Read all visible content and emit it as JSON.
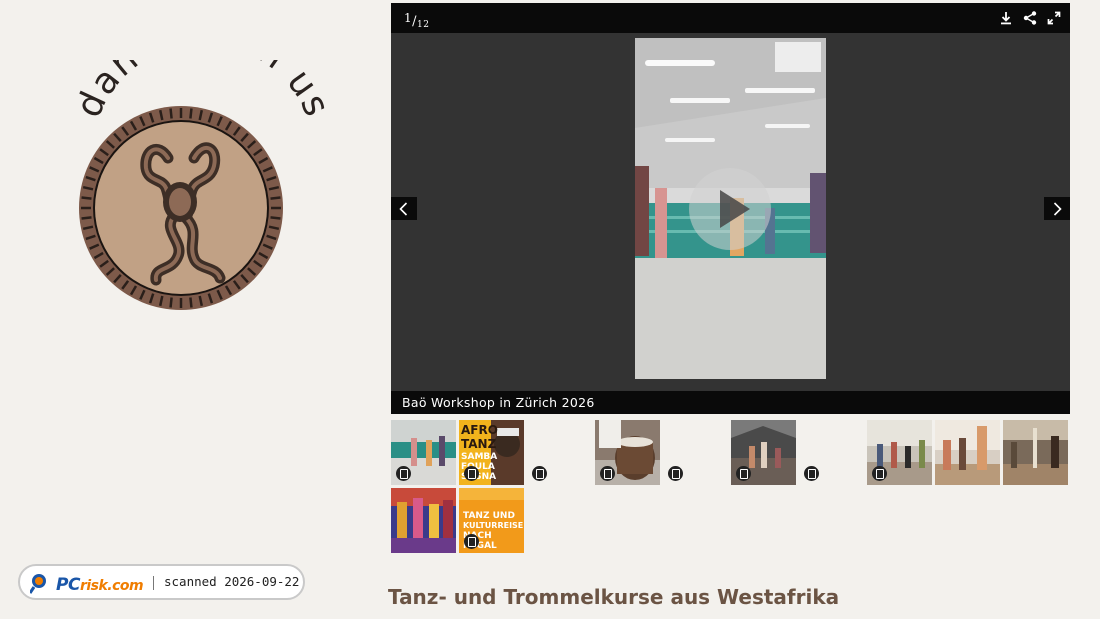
{
  "logo": {
    "text": "dance with us",
    "colors": {
      "ring": "#7d5a4a",
      "inner": "#c1a185",
      "figure": "#3d2e26"
    }
  },
  "gallery": {
    "counter": {
      "current": "1",
      "total": "12"
    },
    "toolbar": {
      "icons": [
        "download-icon",
        "share-icon",
        "fullscreen-icon"
      ]
    },
    "caption": "Baö Workshop in Zürich 2026",
    "prev_icon": "chevron-left-icon",
    "next_icon": "chevron-right-icon"
  },
  "thumbnails": [
    {
      "type": "video",
      "row": 1,
      "col": 0,
      "tone": "studio"
    },
    {
      "type": "video",
      "row": 1,
      "col": 1,
      "tone": "poster-yellow",
      "poster_lines": [
        "AFRO",
        "TANZ",
        "SAMBA",
        "FOULA",
        "SOSNA"
      ]
    },
    {
      "type": "video",
      "row": 1,
      "col": 2,
      "tone": "blank"
    },
    {
      "type": "video",
      "row": 1,
      "col": 3,
      "tone": "drum"
    },
    {
      "type": "video",
      "row": 1,
      "col": 4,
      "tone": "blank"
    },
    {
      "type": "video",
      "row": 1,
      "col": 5,
      "tone": "hall"
    },
    {
      "type": "video",
      "row": 1,
      "col": 6,
      "tone": "blank"
    },
    {
      "type": "video",
      "row": 1,
      "col": 7,
      "tone": "class"
    },
    {
      "type": "image",
      "row": 1,
      "col": 8,
      "tone": "class2"
    },
    {
      "type": "image",
      "row": 1,
      "col": 9,
      "tone": "class3"
    },
    {
      "type": "image",
      "row": 2,
      "col": 0,
      "tone": "colorful"
    },
    {
      "type": "video",
      "row": 2,
      "col": 1,
      "tone": "poster-orange",
      "poster_lines": [
        "TANZ UND",
        "KULTURREISE",
        "NACH",
        "NEGAL"
      ]
    }
  ],
  "heading": "Tanz- und Trommelkurse aus Westafrika",
  "scan_badge": {
    "brand": "PC",
    "brand_suffix": "risk.com",
    "text": "scanned 2026-09-22"
  }
}
